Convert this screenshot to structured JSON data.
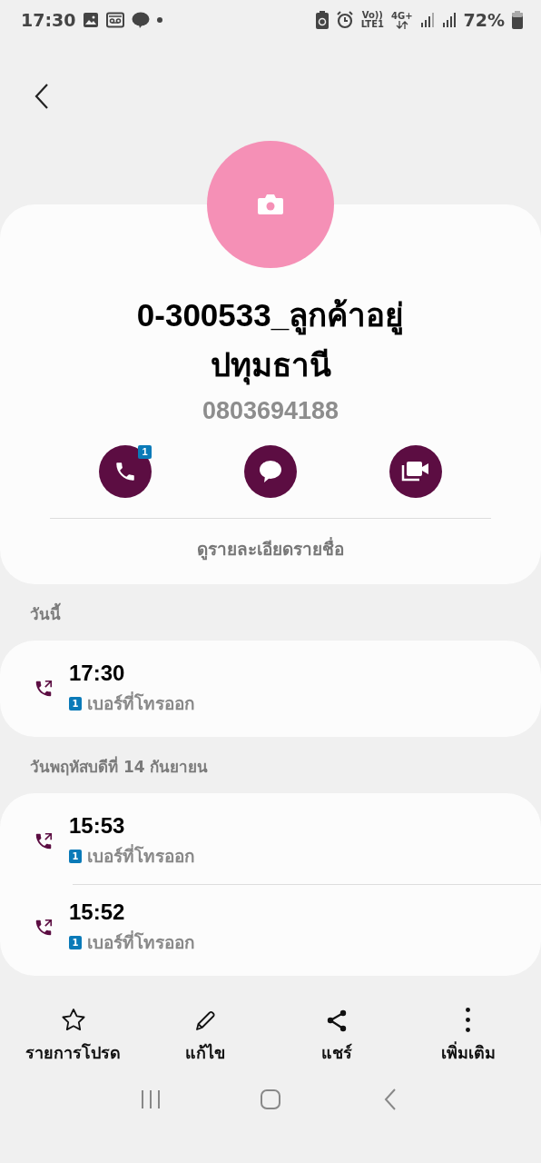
{
  "status_bar": {
    "time": "17:30",
    "volte": "Vo))",
    "lte": "LTE1",
    "network": "4G+",
    "battery": "72%"
  },
  "contact": {
    "name": "0-300533_ลูกค้าอยู่ ปทุมธานี",
    "phone": "0803694188",
    "actions": [
      {
        "kind": "call",
        "badge": "1"
      },
      {
        "kind": "message"
      },
      {
        "kind": "video"
      }
    ],
    "details_link": "ดูรายละเอียดรายชื่อ"
  },
  "call_log": [
    {
      "date": "วันนี้",
      "calls": [
        {
          "kind": "outgoing",
          "time": "17:30",
          "sim": "1",
          "label": "เบอร์ที่โทรออก"
        }
      ]
    },
    {
      "date": "วันพฤหัสบดีที่ 14 กันยายน",
      "calls": [
        {
          "kind": "outgoing",
          "time": "15:53",
          "sim": "1",
          "label": "เบอร์ที่โทรออก"
        },
        {
          "kind": "outgoing",
          "time": "15:52",
          "sim": "1",
          "label": "เบอร์ที่โทรออก"
        }
      ]
    }
  ],
  "bottom_bar": [
    {
      "kind": "favorite",
      "label": "รายการโปรด"
    },
    {
      "kind": "edit",
      "label": "แก้ไข"
    },
    {
      "kind": "share",
      "label": "แชร์"
    },
    {
      "kind": "more",
      "label": "เพิ่มเติม"
    }
  ]
}
